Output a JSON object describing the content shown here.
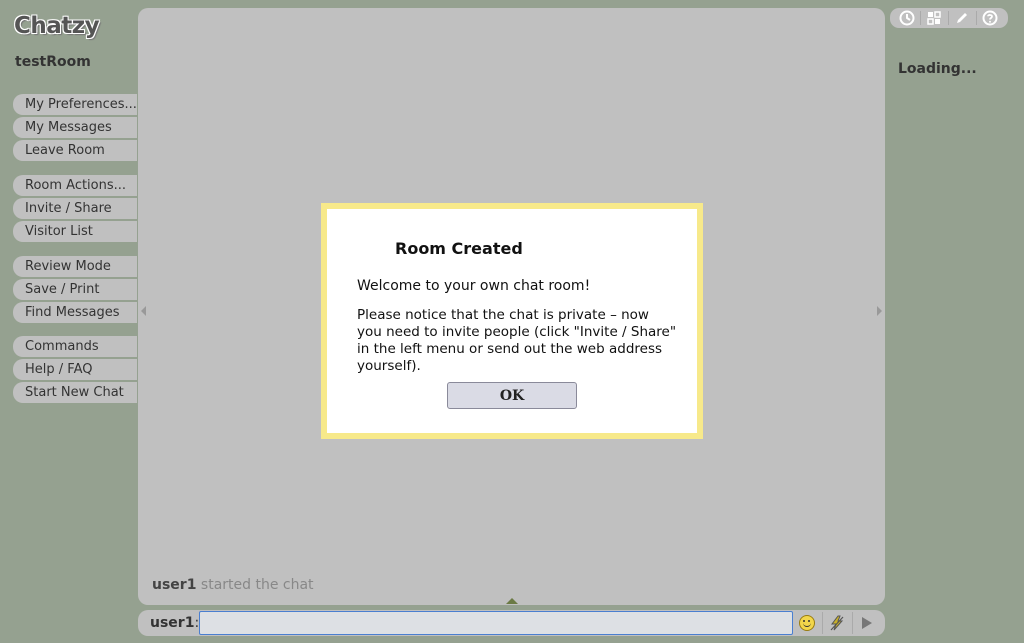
{
  "app": {
    "logo": "Chatzy",
    "room_name": "testRoom"
  },
  "sidebar": {
    "group1": [
      {
        "label": "My Preferences..."
      },
      {
        "label": "My Messages"
      },
      {
        "label": "Leave Room"
      }
    ],
    "group2": [
      {
        "label": "Room Actions..."
      },
      {
        "label": "Invite / Share"
      },
      {
        "label": "Visitor List"
      }
    ],
    "group3": [
      {
        "label": "Review Mode"
      },
      {
        "label": "Save / Print"
      },
      {
        "label": "Find Messages"
      }
    ],
    "group4": [
      {
        "label": "Commands"
      },
      {
        "label": "Help / FAQ"
      },
      {
        "label": "Start New Chat"
      }
    ]
  },
  "chat": {
    "messages": [
      {
        "user": "user1",
        "text": "started the chat"
      }
    ]
  },
  "input_bar": {
    "username": "user1",
    "colon": ":",
    "value": "",
    "icons": [
      "smiley-icon",
      "lightning-icon",
      "send-icon"
    ]
  },
  "top_icons": [
    "clock-icon",
    "grid-icon",
    "pencil-icon",
    "help-icon"
  ],
  "right_panel": {
    "status": "Loading..."
  },
  "modal": {
    "title": "Room Created",
    "welcome": "Welcome to your own chat room!",
    "body": "Please notice that the chat is private – now you need to invite people (click \"Invite / Share\" in the left menu or send out the web address yourself).",
    "ok_label": "OK"
  },
  "colors": {
    "background": "#95a190",
    "panel": "#c0c0c0",
    "modal_border": "#f7e98a",
    "input_border": "#4a7fd0"
  }
}
